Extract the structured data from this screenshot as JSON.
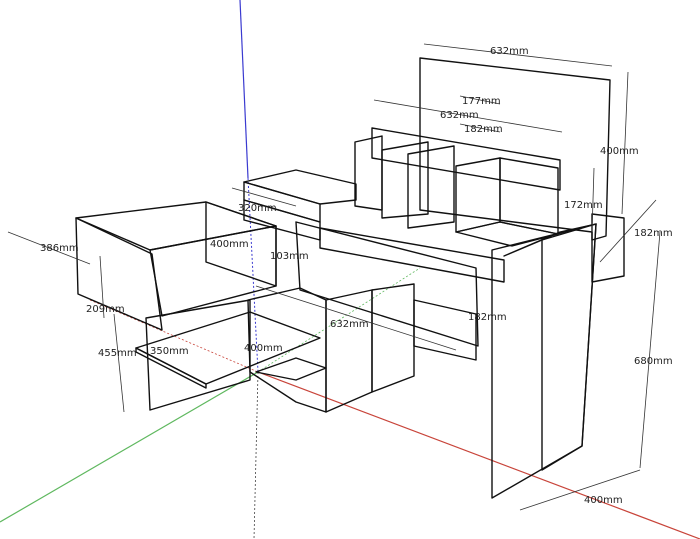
{
  "colors": {
    "background": "#ffffff",
    "panel": "#e9e9e9",
    "panel_shade": "#d6d6d6",
    "panel_dark": "#a2a2a2",
    "edge": "#111111",
    "axis_red": "#c8443a",
    "axis_green": "#5fb85f",
    "axis_blue": "#3a3ad0"
  },
  "dimensions": {
    "top_back_width": "632mm",
    "drawer_177": "177mm",
    "top_632_mid": "632mm",
    "drawer_182_top": "182mm",
    "right_height_400": "400mm",
    "right_172": "172mm",
    "right_182": "182mm",
    "left_320": "320mm",
    "left_386": "386mm",
    "drawer_400": "400mm",
    "drawer_103": "103mm",
    "left_209": "209mm",
    "left_455": "455mm",
    "shelf_350": "350mm",
    "shelf_400": "400mm",
    "front_632": "632mm",
    "front_182": "182mm",
    "total_680": "680mm",
    "bottom_400": "400mm"
  }
}
